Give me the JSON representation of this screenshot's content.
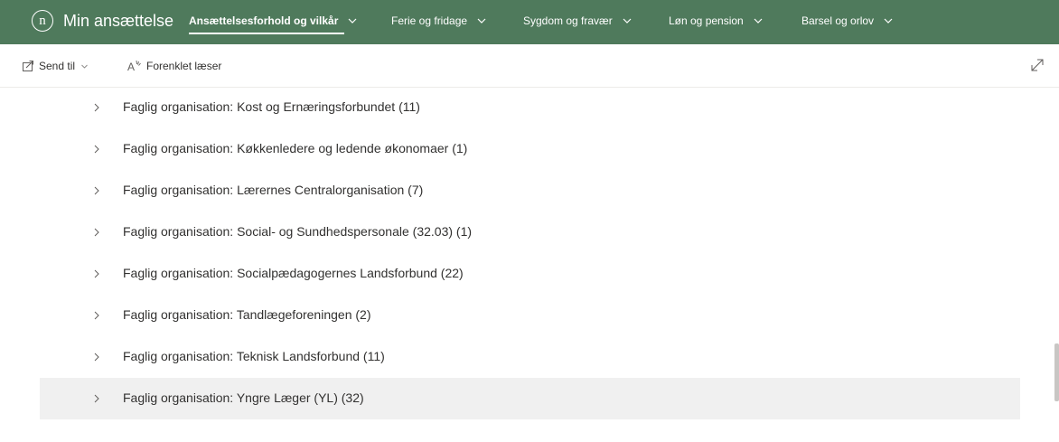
{
  "header": {
    "logo_letter": "n",
    "site_title": "Min ansættelse",
    "nav": [
      {
        "label": "Ansættelsesforhold og vilkår",
        "active": true
      },
      {
        "label": "Ferie og fridage",
        "active": false
      },
      {
        "label": "Sygdom og fravær",
        "active": false
      },
      {
        "label": "Løn og pension",
        "active": false
      },
      {
        "label": "Barsel og orlov",
        "active": false
      }
    ],
    "brand_color": "#4f7a5c"
  },
  "commandbar": {
    "send_label": "Send til",
    "reader_label": "Forenklet læser"
  },
  "list": {
    "items": [
      {
        "label": "Faglig organisation: Kost og Ernæringsforbundet (11)"
      },
      {
        "label": "Faglig organisation: Køkkenledere og ledende økonomaer (1)"
      },
      {
        "label": "Faglig organisation: Lærernes Centralorganisation (7)"
      },
      {
        "label": "Faglig organisation: Social- og Sundhedspersonale (32.03) (1)"
      },
      {
        "label": "Faglig organisation: Socialpædagogernes Landsforbund (22)"
      },
      {
        "label": "Faglig organisation: Tandlægeforeningen (2)"
      },
      {
        "label": "Faglig organisation: Teknisk Landsforbund (11)"
      },
      {
        "label": "Faglig organisation: Yngre Læger (YL) (32)"
      }
    ]
  }
}
